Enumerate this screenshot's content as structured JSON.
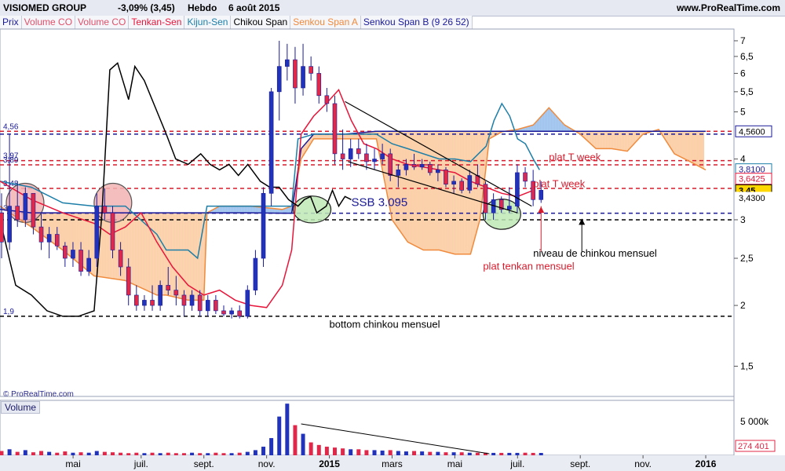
{
  "header": {
    "instrument": "VISIOMED GROUP",
    "change": "-3,09% (3,45)",
    "period": "Hebdo",
    "date": "6 août 2015",
    "site": "www.ProRealTime.com"
  },
  "legend": [
    {
      "label": "Prix",
      "color": "#1a1a99"
    },
    {
      "label": "Volume CO",
      "color": "#e0506a"
    },
    {
      "label": "Volume CO",
      "color": "#e0506a"
    },
    {
      "label": "Tenkan-Sen",
      "color": "#e8163b"
    },
    {
      "label": "Kijun-Sen",
      "color": "#1d7fa8"
    },
    {
      "label": "Chikou Span",
      "color": "#000000"
    },
    {
      "label": "Senkou Span A",
      "color": "#f08a3c"
    },
    {
      "label": "Senkou Span B (9 26 52)",
      "color": "#1a1a99"
    }
  ],
  "copyright": "© ProRealTime.com",
  "volume_title": "Volume",
  "chart_data": {
    "type": "candlestick",
    "y_scale": "log",
    "y_ticks": [
      {
        "value": 7,
        "label": "7"
      },
      {
        "value": 6.5,
        "label": "6,5"
      },
      {
        "value": 6,
        "label": "6"
      },
      {
        "value": 5.5,
        "label": "5,5"
      },
      {
        "value": 5,
        "label": "5"
      },
      {
        "value": 4,
        "label": "4"
      },
      {
        "value": 3,
        "label": "3"
      },
      {
        "value": 2.5,
        "label": "2,5"
      },
      {
        "value": 2,
        "label": "2"
      },
      {
        "value": 1.5,
        "label": "1,5"
      }
    ],
    "x_ticks": [
      {
        "x": 2.33,
        "label": "mai"
      },
      {
        "x": 4.5,
        "label": "juil."
      },
      {
        "x": 6.5,
        "label": "sept."
      },
      {
        "x": 8.5,
        "label": "nov."
      },
      {
        "x": 10.5,
        "label": "2015",
        "bold": true
      },
      {
        "x": 12.5,
        "label": "mars"
      },
      {
        "x": 14.5,
        "label": "mai"
      },
      {
        "x": 16.5,
        "label": "juil."
      },
      {
        "x": 18.5,
        "label": "sept."
      },
      {
        "x": 20.5,
        "label": "nov."
      },
      {
        "x": 22.5,
        "label": "2016",
        "bold": true
      }
    ],
    "x_unit": "months since Jan 2014",
    "candles": [
      [
        3.1,
        3.4,
        2.5,
        2.7
      ],
      [
        2.7,
        4.5,
        2.6,
        3.2
      ],
      [
        3.2,
        3.6,
        2.9,
        3.0
      ],
      [
        3.0,
        3.5,
        2.9,
        3.4
      ],
      [
        3.4,
        3.4,
        2.8,
        2.9
      ],
      [
        2.9,
        3.1,
        2.6,
        2.7
      ],
      [
        2.7,
        2.9,
        2.5,
        2.8
      ],
      [
        2.8,
        2.9,
        2.6,
        2.65
      ],
      [
        2.65,
        2.7,
        2.4,
        2.5
      ],
      [
        2.5,
        2.7,
        2.4,
        2.6
      ],
      [
        2.6,
        2.7,
        2.3,
        2.35
      ],
      [
        2.35,
        2.6,
        2.3,
        2.5
      ],
      [
        2.5,
        3.4,
        2.4,
        3.2
      ],
      [
        3.2,
        3.48,
        3.0,
        3.1
      ],
      [
        3.1,
        3.2,
        2.5,
        2.6
      ],
      [
        2.6,
        2.7,
        2.3,
        2.4
      ],
      [
        2.4,
        2.5,
        2.0,
        2.1
      ],
      [
        2.1,
        2.2,
        1.95,
        2.0
      ],
      [
        2.0,
        2.1,
        1.95,
        2.05
      ],
      [
        2.05,
        2.2,
        1.95,
        2.0
      ],
      [
        2.0,
        2.25,
        1.95,
        2.2
      ],
      [
        2.2,
        2.4,
        2.1,
        2.15
      ],
      [
        2.15,
        2.3,
        2.0,
        2.1
      ],
      [
        2.1,
        2.15,
        1.9,
        2.0
      ],
      [
        2.0,
        2.15,
        1.95,
        2.1
      ],
      [
        2.1,
        2.15,
        1.9,
        1.95
      ],
      [
        1.95,
        2.1,
        1.9,
        2.05
      ],
      [
        2.05,
        2.1,
        1.92,
        1.95
      ],
      [
        1.95,
        2.0,
        1.9,
        1.92
      ],
      [
        1.92,
        1.98,
        1.88,
        1.95
      ],
      [
        1.95,
        2.0,
        1.88,
        1.9
      ],
      [
        1.9,
        2.2,
        1.88,
        2.15
      ],
      [
        2.15,
        2.6,
        2.1,
        2.5
      ],
      [
        2.5,
        3.5,
        2.4,
        3.4
      ],
      [
        3.4,
        5.6,
        3.2,
        5.5
      ],
      [
        5.5,
        7.0,
        4.8,
        6.2
      ],
      [
        6.2,
        6.9,
        5.8,
        6.4
      ],
      [
        6.4,
        6.8,
        5.2,
        5.6
      ],
      [
        5.6,
        6.9,
        5.4,
        6.2
      ],
      [
        6.2,
        6.5,
        5.8,
        6.0
      ],
      [
        6.0,
        6.2,
        5.2,
        5.4
      ],
      [
        5.4,
        5.6,
        5.0,
        5.2
      ],
      [
        5.2,
        5.4,
        3.9,
        4.1
      ],
      [
        4.1,
        4.6,
        3.8,
        4.0
      ],
      [
        4.0,
        4.4,
        3.85,
        4.2
      ],
      [
        4.2,
        4.4,
        4.0,
        4.1
      ],
      [
        4.1,
        4.3,
        3.8,
        3.95
      ],
      [
        3.95,
        4.2,
        3.8,
        4.0
      ],
      [
        4.0,
        4.3,
        3.9,
        4.1
      ],
      [
        4.1,
        4.2,
        3.6,
        3.7
      ],
      [
        3.7,
        3.9,
        3.5,
        3.8
      ],
      [
        3.8,
        4.0,
        3.7,
        3.9
      ],
      [
        3.9,
        4.1,
        3.8,
        3.85
      ],
      [
        3.85,
        4.0,
        3.8,
        3.9
      ],
      [
        3.9,
        3.95,
        3.7,
        3.75
      ],
      [
        3.75,
        3.9,
        3.6,
        3.8
      ],
      [
        3.8,
        3.85,
        3.5,
        3.55
      ],
      [
        3.55,
        3.7,
        3.4,
        3.6
      ],
      [
        3.6,
        3.65,
        3.4,
        3.45
      ],
      [
        3.45,
        3.8,
        3.4,
        3.7
      ],
      [
        3.7,
        3.9,
        3.5,
        3.55
      ],
      [
        3.55,
        3.6,
        3.0,
        3.1
      ],
      [
        3.1,
        3.4,
        3.0,
        3.3
      ],
      [
        3.3,
        3.35,
        3.1,
        3.15
      ],
      [
        3.15,
        3.5,
        3.1,
        3.2
      ],
      [
        3.2,
        3.9,
        3.1,
        3.75
      ],
      [
        3.75,
        3.85,
        3.5,
        3.6
      ],
      [
        3.6,
        3.8,
        3.2,
        3.3
      ],
      [
        3.3,
        3.6,
        3.25,
        3.45
      ]
    ],
    "lines": {
      "chikou": [
        [
          0,
          3.0
        ],
        [
          0.5,
          2.2
        ],
        [
          1,
          2.1
        ],
        [
          1.5,
          1.95
        ],
        [
          2.0,
          1.9
        ],
        [
          2.5,
          1.9
        ],
        [
          3.0,
          1.95
        ],
        [
          3.25,
          3.1
        ],
        [
          3.5,
          6.1
        ],
        [
          3.75,
          6.3
        ],
        [
          4.1,
          5.3
        ],
        [
          4.3,
          6.2
        ],
        [
          4.6,
          5.8
        ],
        [
          4.9,
          5.2
        ],
        [
          5.3,
          4.5
        ],
        [
          5.6,
          4.0
        ],
        [
          6.0,
          3.9
        ],
        [
          6.4,
          4.1
        ],
        [
          6.7,
          3.9
        ],
        [
          7.0,
          3.8
        ],
        [
          7.3,
          3.9
        ],
        [
          7.6,
          3.7
        ],
        [
          7.9,
          3.9
        ],
        [
          8.3,
          3.6
        ],
        [
          8.6,
          3.5
        ],
        [
          8.9,
          3.5
        ],
        [
          9.2,
          3.3
        ],
        [
          9.5,
          3.2
        ],
        [
          9.7,
          3.3
        ],
        [
          9.9,
          3.35
        ],
        [
          10.1,
          3.1
        ],
        [
          10.4,
          3.2
        ],
        [
          10.6,
          3.45
        ],
        [
          10.8,
          3.2
        ],
        [
          11.0,
          3.35
        ],
        [
          11.2,
          3.3
        ]
      ],
      "tenkan": [
        [
          0,
          3.6
        ],
        [
          1,
          3.3
        ],
        [
          2,
          3.1
        ],
        [
          3,
          2.95
        ],
        [
          3.5,
          2.8
        ],
        [
          4,
          2.9
        ],
        [
          4.5,
          3.1
        ],
        [
          5,
          2.7
        ],
        [
          5.5,
          2.4
        ],
        [
          6,
          2.2
        ],
        [
          6.5,
          2.1
        ],
        [
          7,
          2.15
        ],
        [
          7.5,
          2.05
        ],
        [
          8,
          2.0
        ],
        [
          8.5,
          1.98
        ],
        [
          9,
          2.2
        ],
        [
          9.3,
          2.6
        ],
        [
          9.6,
          4.5
        ],
        [
          10,
          4.9
        ],
        [
          10.4,
          5.2
        ],
        [
          10.8,
          5.55
        ],
        [
          11.2,
          4.8
        ],
        [
          11.6,
          4.3
        ],
        [
          12.0,
          4.2
        ],
        [
          12.5,
          4.0
        ],
        [
          13.0,
          3.9
        ],
        [
          13.5,
          3.85
        ],
        [
          14.0,
          3.8
        ],
        [
          14.5,
          3.75
        ],
        [
          15.0,
          3.6
        ],
        [
          15.5,
          3.5
        ],
        [
          16.0,
          3.4
        ],
        [
          16.5,
          3.35
        ],
        [
          17.0,
          3.45
        ]
      ],
      "kijun": [
        [
          0,
          3.6
        ],
        [
          1,
          3.5
        ],
        [
          2,
          3.25
        ],
        [
          3,
          3.2
        ],
        [
          4,
          3.2
        ],
        [
          5,
          2.8
        ],
        [
          5.3,
          2.6
        ],
        [
          6,
          2.6
        ],
        [
          6.3,
          2.5
        ],
        [
          6.6,
          3.2
        ],
        [
          7,
          3.2
        ],
        [
          8,
          3.2
        ],
        [
          9,
          3.2
        ],
        [
          9.3,
          3.2
        ],
        [
          9.5,
          4.4
        ],
        [
          10,
          4.5
        ],
        [
          11,
          4.5
        ],
        [
          12,
          4.5
        ],
        [
          12.5,
          4.3
        ],
        [
          13,
          4.2
        ],
        [
          14,
          4.0
        ],
        [
          14.5,
          4.0
        ],
        [
          15,
          3.95
        ],
        [
          15.5,
          4.25
        ],
        [
          15.75,
          4.8
        ],
        [
          16.0,
          5.2
        ],
        [
          16.25,
          4.9
        ],
        [
          16.5,
          4.4
        ],
        [
          16.75,
          4.3
        ],
        [
          17.0,
          4.0
        ],
        [
          17.2,
          3.8
        ]
      ],
      "ssa": [
        [
          0,
          3.2
        ],
        [
          1,
          2.9
        ],
        [
          2,
          2.6
        ],
        [
          3,
          2.3
        ],
        [
          4,
          2.25
        ],
        [
          5,
          2.1
        ],
        [
          5.3,
          2.1
        ],
        [
          6,
          2.05
        ],
        [
          6.5,
          2.05
        ],
        [
          6.6,
          3.1
        ],
        [
          7,
          3.2
        ],
        [
          8,
          3.2
        ],
        [
          9,
          3.15
        ],
        [
          9.3,
          3.2
        ],
        [
          9.6,
          4.0
        ],
        [
          10,
          4.4
        ],
        [
          11,
          4.4
        ],
        [
          12,
          4.4
        ],
        [
          12.5,
          3.0
        ],
        [
          13,
          2.7
        ],
        [
          13.5,
          2.6
        ],
        [
          14,
          2.6
        ],
        [
          14.5,
          2.55
        ],
        [
          15,
          2.55
        ],
        [
          15.3,
          3.0
        ],
        [
          15.6,
          4.4
        ],
        [
          16,
          4.55
        ],
        [
          16.5,
          4.6
        ],
        [
          17,
          4.7
        ],
        [
          17.5,
          5.1
        ],
        [
          18,
          4.7
        ],
        [
          18.5,
          4.5
        ],
        [
          19,
          4.2
        ],
        [
          19.5,
          4.2
        ],
        [
          20,
          4.15
        ],
        [
          20.5,
          4.5
        ],
        [
          21,
          4.6
        ],
        [
          21.5,
          4.1
        ],
        [
          22,
          3.95
        ],
        [
          22.5,
          3.8
        ]
      ],
      "ssb": [
        [
          0,
          3.15
        ],
        [
          1,
          3.1
        ],
        [
          2,
          3.1
        ],
        [
          3,
          3.1
        ],
        [
          4,
          3.1
        ],
        [
          5,
          3.1
        ],
        [
          6,
          3.1
        ],
        [
          7,
          3.1
        ],
        [
          8,
          3.1
        ],
        [
          9,
          3.095
        ],
        [
          9.3,
          3.095
        ],
        [
          9.6,
          4.2
        ],
        [
          10,
          4.5
        ],
        [
          11,
          4.5
        ],
        [
          12,
          4.56
        ],
        [
          13,
          4.56
        ],
        [
          14,
          4.56
        ],
        [
          15,
          4.56
        ],
        [
          15.6,
          4.56
        ],
        [
          16,
          4.56
        ],
        [
          17,
          4.56
        ],
        [
          18,
          4.56
        ],
        [
          19,
          4.56
        ],
        [
          20,
          4.56
        ],
        [
          21,
          4.56
        ],
        [
          22,
          4.56
        ],
        [
          22.5,
          4.56
        ]
      ]
    },
    "hlines": [
      {
        "value": 4.56,
        "color": "#d81b2c",
        "label": "4,56"
      },
      {
        "value": 4.5,
        "color": "#1a1a99",
        "label": ""
      },
      {
        "value": 3.97,
        "color": "#d81b2c",
        "label": "3,97"
      },
      {
        "value": 3.89,
        "color": "#d81b2c",
        "label": "3,89"
      },
      {
        "value": 3.48,
        "color": "#d81b2c",
        "label": "3,48"
      },
      {
        "value": 3.095,
        "color": "#1a1a99",
        "label": "3"
      },
      {
        "value": 3.0,
        "color": "#000000",
        "label": ""
      },
      {
        "value": 1.9,
        "color": "#000000",
        "label": "1,9"
      }
    ],
    "right_labels": [
      {
        "value": 4.56,
        "text": "4,5600",
        "bg": "#ffffff",
        "fg": "#000000",
        "border": "#1a1a99"
      },
      {
        "value": 3.81,
        "text": "3,8100",
        "bg": "#ffffff",
        "fg": "#1a1a99",
        "border": "#1d7fa8"
      },
      {
        "value": 3.6425,
        "text": "3,6425",
        "bg": "#ffffff",
        "fg": "#e8163b",
        "border": "#e8163b"
      },
      {
        "value": 3.45,
        "text": "3,45",
        "bg": "#ffd700",
        "fg": "#000000",
        "border": "#000000"
      },
      {
        "value": 3.33,
        "text": "3,4300",
        "bg": "#ffffff",
        "fg": "#000000",
        "border": "#ffffff"
      }
    ],
    "annotations": [
      {
        "text": "SSB 3.095",
        "x": 11.2,
        "y": 3.2,
        "color": "#1a1a99",
        "size": 15
      },
      {
        "text": "plat T week",
        "x": 17.5,
        "y": 3.97,
        "color": "#d81b2c",
        "size": 13
      },
      {
        "text": "plat T week",
        "x": 17.0,
        "y": 3.5,
        "color": "#d81b2c",
        "size": 13
      },
      {
        "text": "niveau de chinkou mensuel",
        "x": 17.0,
        "y": 2.52,
        "color": "#000000",
        "size": 13
      },
      {
        "text": "plat tenkan mensuel",
        "x": 15.4,
        "y": 2.37,
        "color": "#d81b2c",
        "size": 13
      },
      {
        "text": "bottom  chinkou mensuel",
        "x": 10.5,
        "y": 1.8,
        "color": "#000000",
        "size": 13
      }
    ],
    "trendlines": [
      {
        "from": [
          11.0,
          5.25
        ],
        "to": [
          16.95,
          3.2
        ]
      },
      {
        "from": [
          11.1,
          3.95
        ],
        "to": [
          16.5,
          3.1
        ]
      }
    ],
    "ellipses": [
      {
        "cx": 0.8,
        "cy": 3.25,
        "rx": 0.6,
        "ry": 0.3,
        "fill": "#f2b3b3",
        "stroke": "#555555"
      },
      {
        "cx": 3.6,
        "cy": 3.25,
        "rx": 0.6,
        "ry": 0.3,
        "fill": "#f2b3b3",
        "stroke": "#555555"
      },
      {
        "cx": 9.95,
        "cy": 3.15,
        "rx": 0.6,
        "ry": 0.2,
        "fill": "#bfe8b5",
        "stroke": "#222222"
      },
      {
        "cx": 16.0,
        "cy": 3.08,
        "rx": 0.6,
        "ry": 0.22,
        "fill": "#bfe8b5",
        "stroke": "#222222"
      }
    ],
    "volume": {
      "axis_label": "5 000k",
      "last_label": "274 401",
      "values": [
        0.5,
        0.7,
        0.4,
        0.6,
        0.35,
        0.5,
        0.4,
        0.3,
        0.45,
        0.3,
        0.35,
        0.3,
        0.5,
        0.4,
        0.35,
        0.3,
        0.25,
        0.3,
        0.25,
        0.3,
        0.25,
        0.3,
        0.25,
        0.25,
        0.3,
        0.25,
        0.25,
        0.3,
        0.25,
        0.25,
        0.3,
        0.4,
        0.6,
        1.0,
        2.0,
        4.5,
        6.0,
        3.5,
        2.5,
        1.5,
        1.2,
        1.0,
        0.9,
        0.8,
        0.7,
        0.7,
        0.6,
        0.6,
        0.55,
        0.6,
        0.5,
        0.45,
        0.5,
        0.45,
        0.4,
        0.4,
        0.35,
        0.35,
        0.35,
        0.3,
        0.3,
        0.3,
        0.28,
        0.28,
        0.28,
        0.28,
        0.3,
        0.28,
        0.274
      ]
    }
  }
}
